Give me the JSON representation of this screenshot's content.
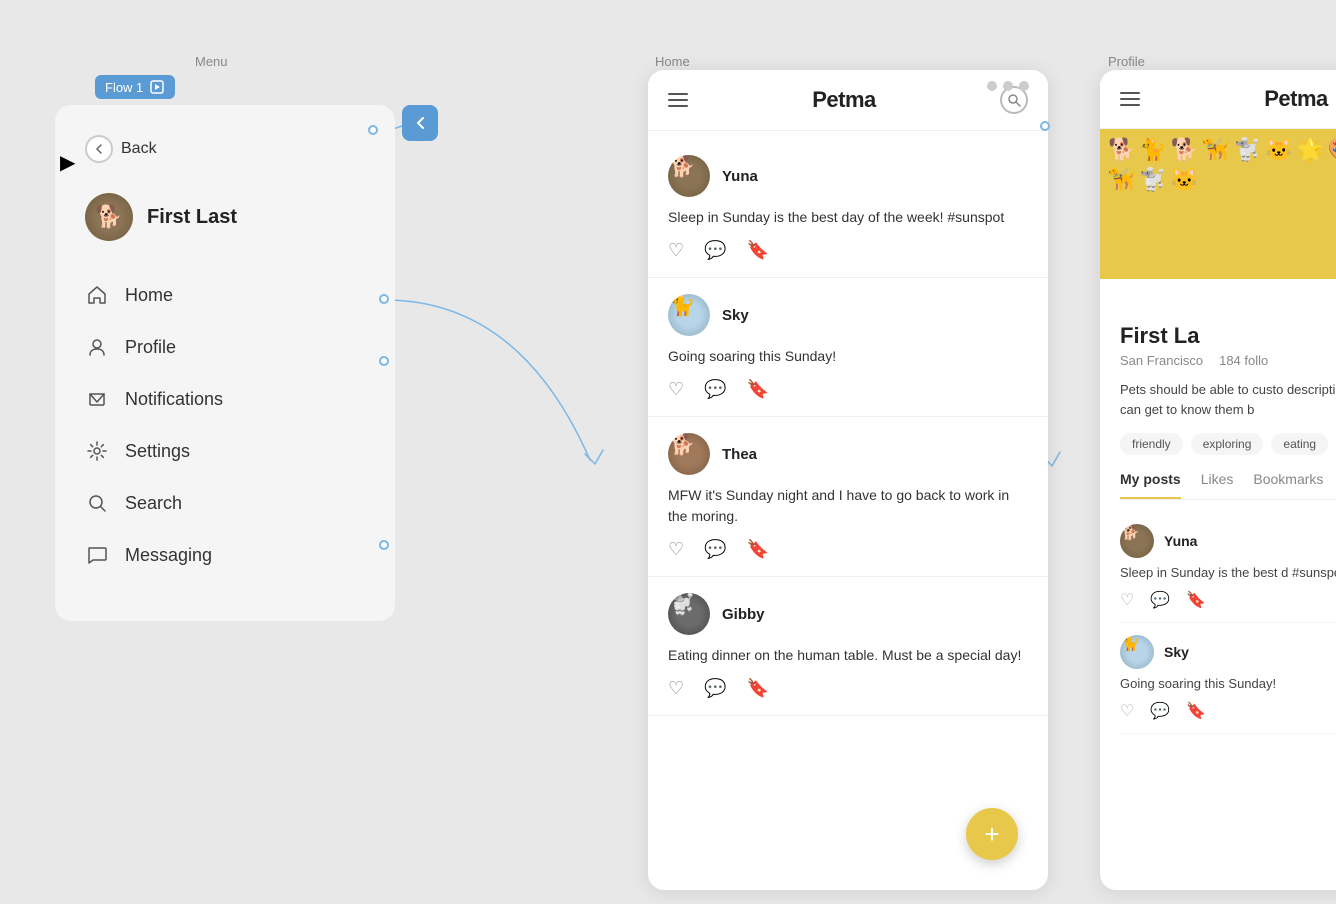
{
  "flow_badge": {
    "label": "Flow 1",
    "icon": "▶"
  },
  "top_labels": {
    "menu": "Menu",
    "home": "Home",
    "profile": "Profile"
  },
  "menu": {
    "back_label": "Back",
    "user": {
      "name": "First Last",
      "avatar_emoji": "🐕"
    },
    "items": [
      {
        "id": "home",
        "label": "Home",
        "icon": "home"
      },
      {
        "id": "profile",
        "label": "Profile",
        "icon": "person"
      },
      {
        "id": "notifications",
        "label": "Notifications",
        "icon": "flag"
      },
      {
        "id": "settings",
        "label": "Settings",
        "icon": "gear"
      },
      {
        "id": "search",
        "label": "Search",
        "icon": "search"
      },
      {
        "id": "messaging",
        "label": "Messaging",
        "icon": "chat"
      }
    ]
  },
  "home_screen": {
    "app_name": "Petma",
    "posts": [
      {
        "id": "p1",
        "user": "Yuna",
        "avatar_emoji": "🐕",
        "avatar_class": "dog-avatar-1",
        "text": "Sleep in Sunday is the best day of the week! #sunspot"
      },
      {
        "id": "p2",
        "user": "Sky",
        "avatar_emoji": "🐈",
        "avatar_class": "dog-avatar-2",
        "text": "Going soaring this Sunday!"
      },
      {
        "id": "p3",
        "user": "Thea",
        "avatar_emoji": "🐕",
        "avatar_class": "dog-avatar-3",
        "text": "MFW it's Sunday night and I have to go back to work in the moring."
      },
      {
        "id": "p4",
        "user": "Gibby",
        "avatar_emoji": "🐩",
        "avatar_class": "dog-avatar-4",
        "text": "Eating dinner on the human table. Must be a special day!"
      }
    ],
    "fab_label": "+"
  },
  "profile_screen": {
    "app_name": "Petma",
    "user": {
      "name": "First La",
      "full_name": "First Last",
      "location": "San Francisco",
      "followers": "184 follo",
      "bio": "Pets should be able to custo description to tell other pets they can get to know them b",
      "tags": [
        "friendly",
        "exploring",
        "eating"
      ],
      "avatar_emoji": "🐕"
    },
    "tabs": [
      {
        "label": "My posts",
        "active": true
      },
      {
        "label": "Likes",
        "active": false
      },
      {
        "label": "Bookmarks",
        "active": false
      }
    ],
    "mini_posts": [
      {
        "user": "Yuna",
        "avatar_emoji": "🐕",
        "avatar_class": "dog-avatar-1",
        "text": "Sleep in Sunday is the best d #sunspot"
      },
      {
        "user": "Sky",
        "avatar_emoji": "🐈",
        "avatar_class": "dog-avatar-2",
        "text": "Going soaring this Sunday!"
      }
    ]
  }
}
